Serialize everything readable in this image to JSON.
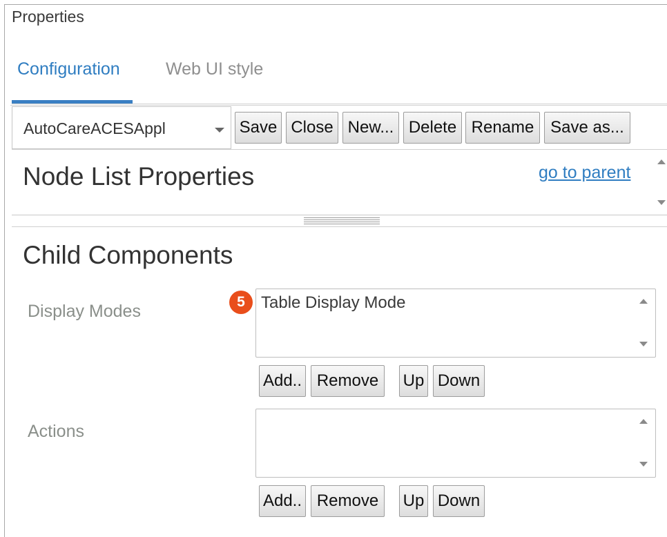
{
  "panel": {
    "title": "Properties"
  },
  "tabs": [
    {
      "label": "Configuration",
      "active": true
    },
    {
      "label": "Web UI style",
      "active": false
    }
  ],
  "toolbar": {
    "config_select_value": "AutoCareACESAppl",
    "buttons": {
      "save": "Save",
      "close": "Close",
      "new": "New...",
      "delete": "Delete",
      "rename": "Rename",
      "save_as": "Save as..."
    }
  },
  "properties_pane": {
    "title": "Node List Properties",
    "parent_link": "go to parent"
  },
  "child_components": {
    "title": "Child Components",
    "display_modes": {
      "label": "Display Modes",
      "items": [
        "Table Display Mode"
      ],
      "badge": "5",
      "buttons": {
        "add": "Add..",
        "remove": "Remove",
        "up": "Up",
        "down": "Down"
      }
    },
    "actions": {
      "label": "Actions",
      "items": [],
      "buttons": {
        "add": "Add..",
        "remove": "Remove",
        "up": "Up",
        "down": "Down"
      }
    }
  },
  "colors": {
    "accent": "#2f7dc1",
    "badge": "#e94e1b",
    "label": "#8a8f8a"
  },
  "icons": [
    "chevron-down-icon",
    "scroll-up-icon",
    "scroll-down-icon",
    "splitter-handle-icon"
  ]
}
